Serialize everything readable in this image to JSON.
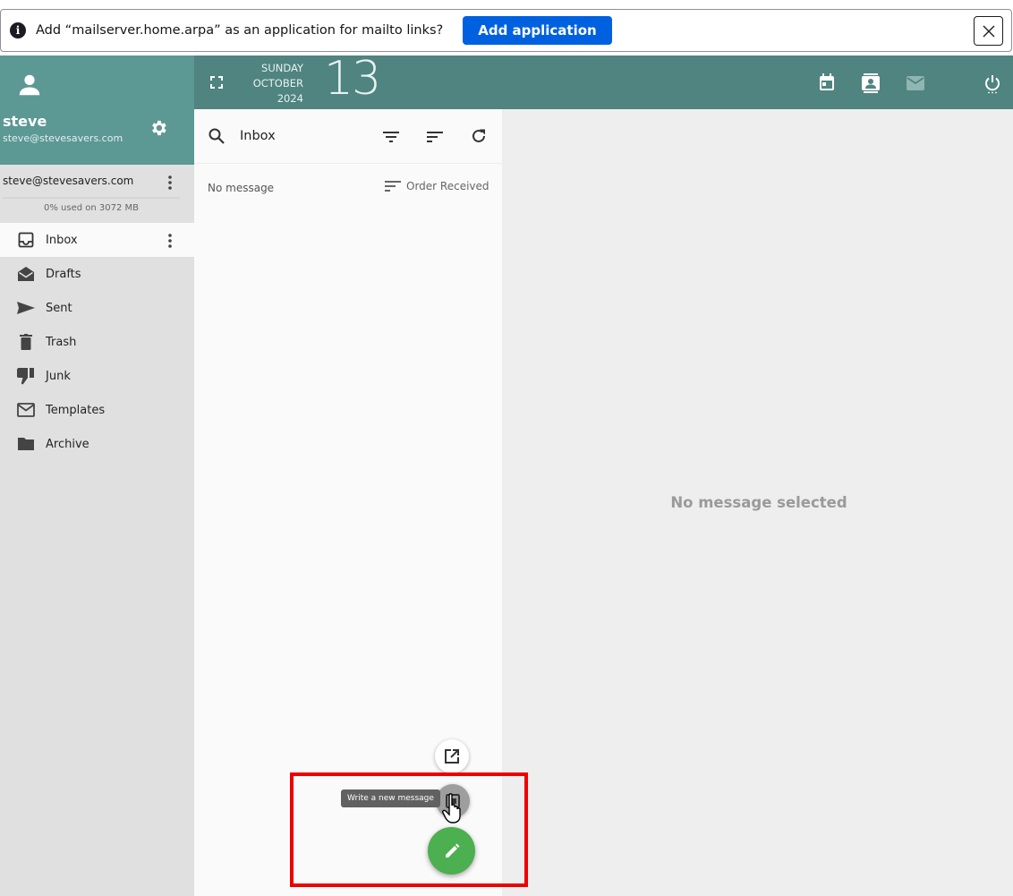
{
  "notification": {
    "message": "Add “mailserver.home.arpa” as an application for mailto links?",
    "add_button": "Add application",
    "close_label": "×"
  },
  "profile": {
    "name": "steve",
    "email": "steve@stevesavers.com"
  },
  "account": {
    "email": "steve@stevesavers.com",
    "quota": "0% used on 3072 MB",
    "quota_fraction": 0.0
  },
  "folders": [
    {
      "label": "Inbox",
      "icon": "inbox-icon",
      "active": true
    },
    {
      "label": "Drafts",
      "icon": "drafts-icon",
      "active": false
    },
    {
      "label": "Sent",
      "icon": "send-icon",
      "active": false
    },
    {
      "label": "Trash",
      "icon": "trash-icon",
      "active": false
    },
    {
      "label": "Junk",
      "icon": "thumb-down-icon",
      "active": false
    },
    {
      "label": "Templates",
      "icon": "envelope-icon",
      "active": false
    },
    {
      "label": "Archive",
      "icon": "folder-icon",
      "active": false
    }
  ],
  "topbar": {
    "day_name": "SUNDAY",
    "month": "OCTOBER",
    "year": "2024",
    "day_number": "13"
  },
  "list": {
    "title": "Inbox",
    "empty_text": "No message",
    "order_label": "Order Received"
  },
  "reader": {
    "empty_text": "No message selected"
  },
  "compose": {
    "tooltip": "Write a new message"
  },
  "colors": {
    "sidebar_header": "#5c9894",
    "topbar": "#4f8480",
    "fab": "#4caf50",
    "highlight": "#ee0000",
    "notif_button": "#0061e0"
  }
}
